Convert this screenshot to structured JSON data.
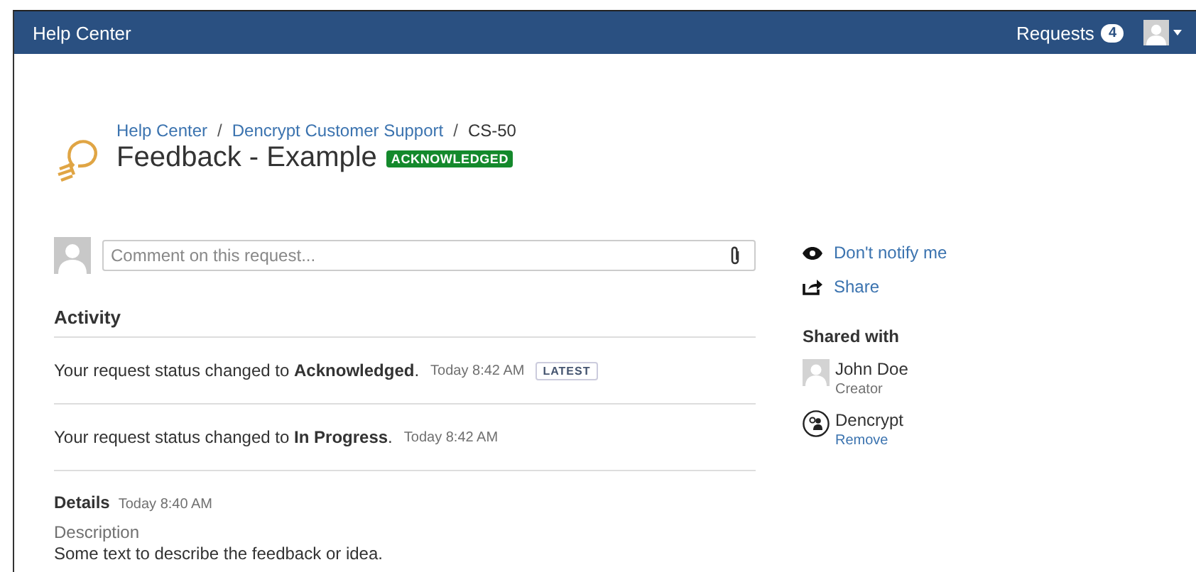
{
  "header": {
    "title": "Help Center",
    "requests_label": "Requests",
    "requests_count": "4"
  },
  "breadcrumbs": [
    {
      "label": "Help Center",
      "link": true,
      "separator": "/"
    },
    {
      "label": "Dencrypt Customer Support",
      "link": true,
      "separator": "/"
    },
    {
      "label": "CS-50",
      "link": false
    }
  ],
  "request": {
    "title": "Feedback - Example",
    "status": "ACKNOWLEDGED"
  },
  "comment": {
    "placeholder": "Comment on this request..."
  },
  "activity": {
    "heading": "Activity",
    "items": [
      {
        "text": "Your request status changed to **Acknowledged**.",
        "time": "Today 8:42 AM",
        "lozenge": "LATEST"
      },
      {
        "text": "Your request status changed to **In Progress**.",
        "time": "Today 8:42 AM"
      }
    ]
  },
  "details": {
    "heading": "Details",
    "time": "Today 8:40 AM",
    "field_label": "Description",
    "field_value": "Some text to describe the feedback or idea."
  },
  "sidebar": {
    "actions": [
      {
        "kind": "eye",
        "label": "Don't notify me"
      },
      {
        "kind": "share",
        "label": "Share"
      }
    ],
    "shared_heading": "Shared with",
    "people": [
      {
        "kind": "user",
        "name": "John Doe",
        "sub": "Creator",
        "sub_link": false
      },
      {
        "kind": "org",
        "name": "Dencrypt",
        "sub": "Remove",
        "sub_link": true
      }
    ]
  }
}
